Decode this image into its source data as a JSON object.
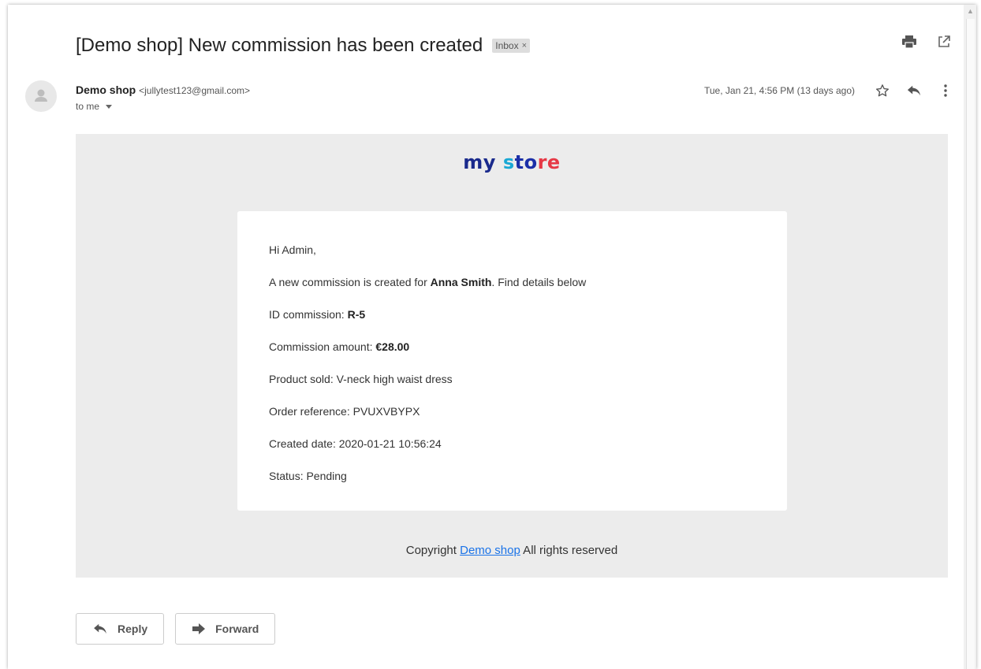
{
  "email": {
    "subject": "[Demo shop] New commission has been created",
    "label": "Inbox",
    "label_remove": "×",
    "sender_name": "Demo shop",
    "sender_email": "<jullytest123@gmail.com>",
    "to": "to me",
    "date": "Tue, Jan 21, 4:56 PM (13 days ago)"
  },
  "logo": {
    "part1": "my",
    "part2": "s",
    "part3": "to",
    "part4": "re"
  },
  "body": {
    "greeting": "Hi Admin,",
    "intro_prefix": "A new commission is created for ",
    "intro_name": "Anna Smith",
    "intro_suffix": ". Find details below",
    "id_label": "ID commission: ",
    "id_value": "R-5",
    "amount_label": "Commission amount: ",
    "amount_value": "€28.00",
    "product": "Product sold: V-neck high waist dress",
    "order_ref": "Order reference: PVUXVBYPX",
    "created": "Created date: 2020-01-21 10:56:24",
    "status": "Status: Pending"
  },
  "footer": {
    "copyright_prefix": "Copyright ",
    "copyright_link": "Demo shop",
    "copyright_suffix": " All rights reserved"
  },
  "actions": {
    "reply": "Reply",
    "forward": "Forward"
  },
  "colors": {
    "link": "#1a73e8",
    "body_bg": "#ececec",
    "chip_bg": "#dddddd"
  },
  "icons": [
    "print-icon",
    "open-new-window-icon",
    "star-icon",
    "reply-icon",
    "more-vert-icon",
    "avatar-icon",
    "forward-icon"
  ]
}
